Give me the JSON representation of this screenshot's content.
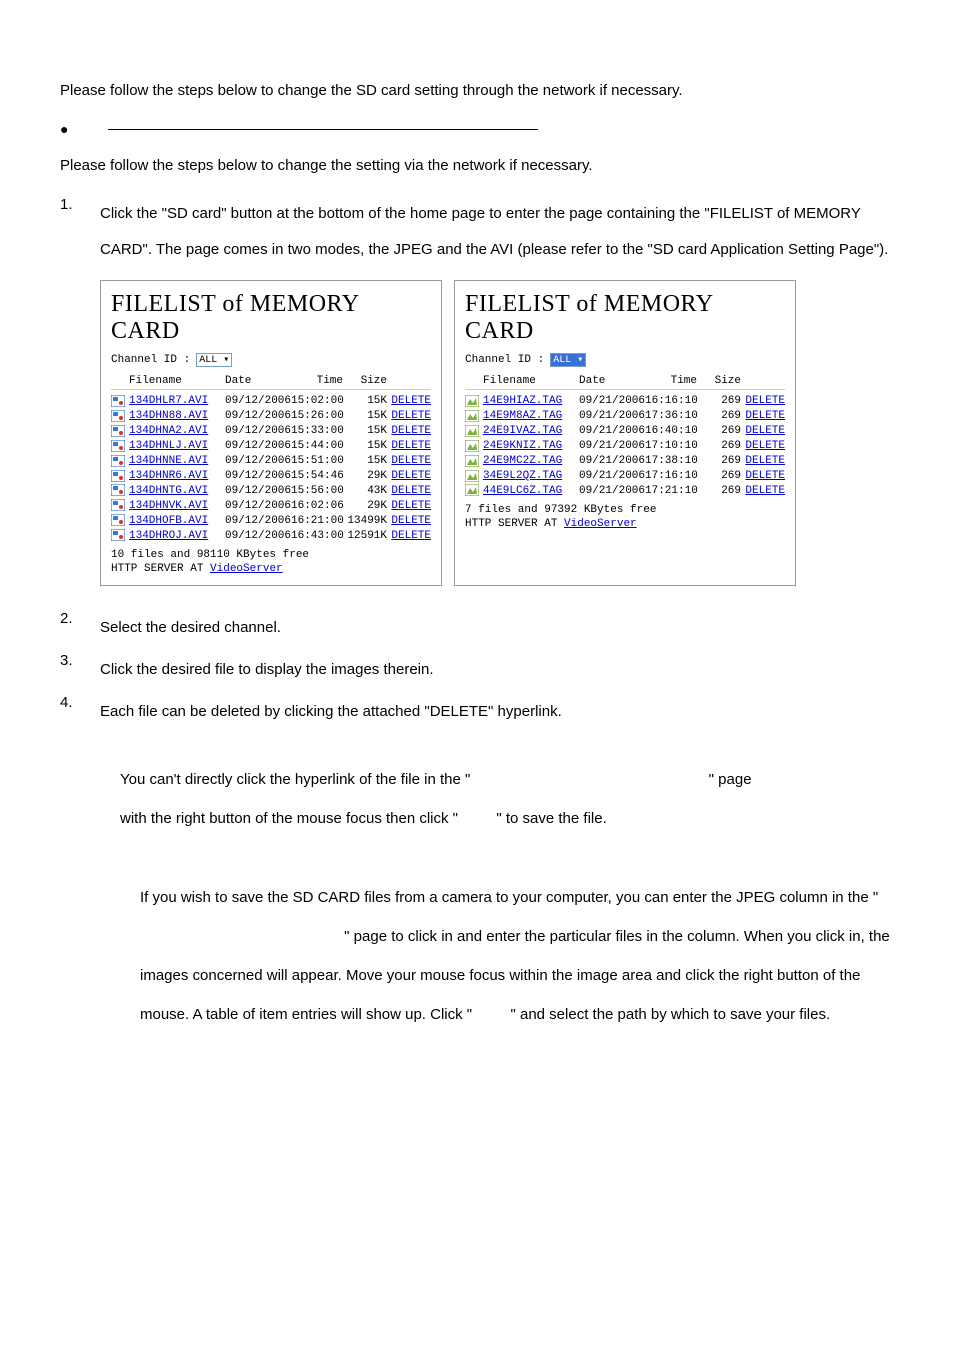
{
  "intro1": "Please follow the steps below to change the SD card setting through the network if necessary.",
  "intro2": "Please follow the steps below to change the setting via the network if necessary.",
  "steps": {
    "s1num": "1.",
    "s1": "Click the \"SD card\" button at the bottom of the home page to enter the page containing the \"FILELIST of MEMORY CARD\". The page comes in two modes, the JPEG and the AVI (please refer to the \"SD card Application Setting Page\").",
    "s2num": "2.",
    "s2": "Select the desired channel.",
    "s3num": "3.",
    "s3": "Click the desired file to display the images therein.",
    "s4num": "4.",
    "s4": "Each file can be deleted by clicking the attached \"DELETE\" hyperlink."
  },
  "cardTitle": "FILELIST of MEMORY CARD",
  "channelLabel": "Channel ID :",
  "selectValue": "ALL",
  "headers": {
    "file": "Filename",
    "date": "Date",
    "time": "Time",
    "size": "Size"
  },
  "left": {
    "rows": [
      {
        "name": "134DHLR7.AVI",
        "date": "09/12/2006",
        "time": "15:02:00",
        "size": "15K"
      },
      {
        "name": "134DHN88.AVI",
        "date": "09/12/2006",
        "time": "15:26:00",
        "size": "15K"
      },
      {
        "name": "134DHNA2.AVI",
        "date": "09/12/2006",
        "time": "15:33:00",
        "size": "15K"
      },
      {
        "name": "134DHNLJ.AVI",
        "date": "09/12/2006",
        "time": "15:44:00",
        "size": "15K"
      },
      {
        "name": "134DHNNE.AVI",
        "date": "09/12/2006",
        "time": "15:51:00",
        "size": "15K"
      },
      {
        "name": "134DHNR6.AVI",
        "date": "09/12/2006",
        "time": "15:54:46",
        "size": "29K"
      },
      {
        "name": "134DHNTG.AVI",
        "date": "09/12/2006",
        "time": "15:56:00",
        "size": "43K"
      },
      {
        "name": "134DHNVK.AVI",
        "date": "09/12/2006",
        "time": "16:02:06",
        "size": "29K"
      },
      {
        "name": "134DHOFB.AVI",
        "date": "09/12/2006",
        "time": "16:21:00",
        "size": "13499K"
      },
      {
        "name": "134DHROJ.AVI",
        "date": "09/12/2006",
        "time": "16:43:00",
        "size": "12591K"
      }
    ],
    "foot1": "10 files and 98110 KBytes free",
    "foot2a": "HTTP SERVER AT ",
    "foot2b": "VideoServer"
  },
  "right": {
    "rows": [
      {
        "name": "14E9HIAZ.TAG",
        "date": "09/21/2006",
        "time": "16:16:10",
        "size": "269"
      },
      {
        "name": "14E9M8AZ.TAG",
        "date": "09/21/2006",
        "time": "17:36:10",
        "size": "269"
      },
      {
        "name": "24E9IVAZ.TAG",
        "date": "09/21/2006",
        "time": "16:40:10",
        "size": "269"
      },
      {
        "name": "24E9KNIZ.TAG",
        "date": "09/21/2006",
        "time": "17:10:10",
        "size": "269"
      },
      {
        "name": "24E9MC2Z.TAG",
        "date": "09/21/2006",
        "time": "17:38:10",
        "size": "269"
      },
      {
        "name": "34E9L2QZ.TAG",
        "date": "09/21/2006",
        "time": "17:16:10",
        "size": "269"
      },
      {
        "name": "44E9LC6Z.TAG",
        "date": "09/21/2006",
        "time": "17:21:10",
        "size": "269"
      }
    ],
    "foot1": "7 files and 97392 KBytes free",
    "foot2a": "HTTP SERVER AT ",
    "foot2b": "VideoServer"
  },
  "deleteLabel": "DELETE",
  "note1a": "You can't directly click the hyperlink of the file in the \"",
  "note1b": "\" page",
  "note2a": "with the right button of the mouse focus then click \"",
  "note2b": "\" to save the file.",
  "note3": "If you wish to save the SD CARD files from a camera to your computer, you can enter the JPEG column in the \"",
  "note3b": "\" page to click in and enter the particular files in the column. When you click in, the images concerned will appear. Move your mouse focus within the image area and click the right button of the mouse. A table of item entries will show up. Click \"",
  "note3c": "\" and select the path by which to save your files."
}
